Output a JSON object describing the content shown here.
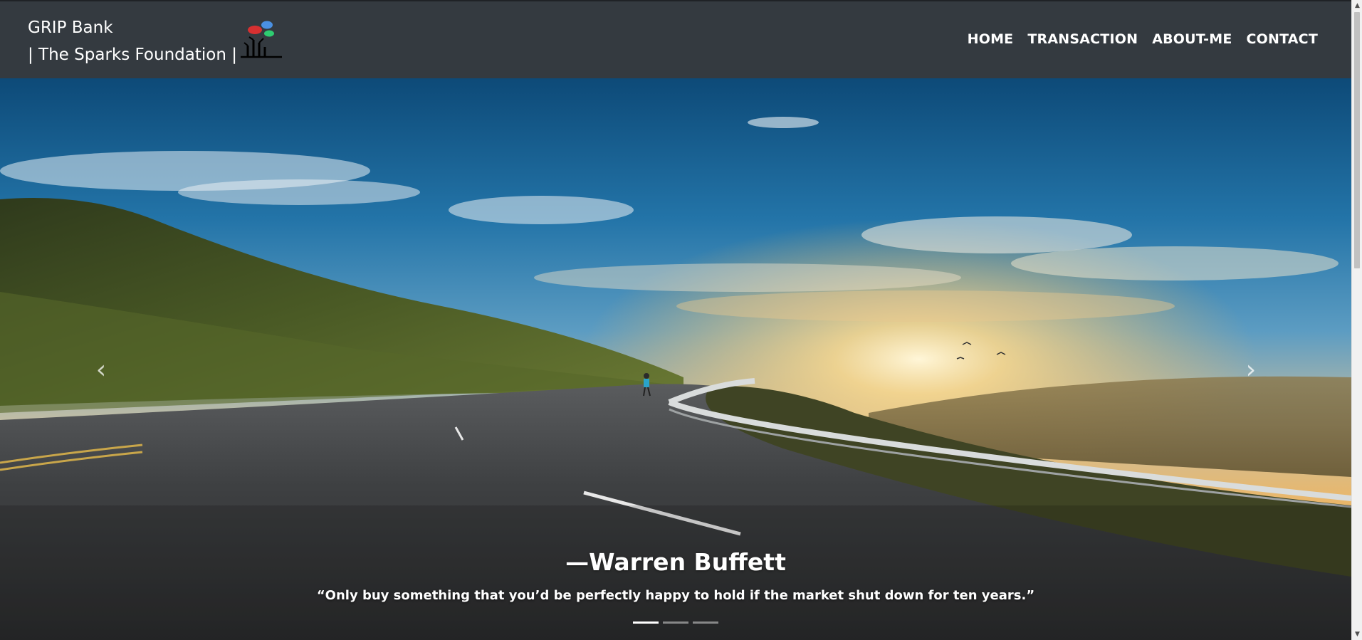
{
  "navbar": {
    "brand_line1": "GRIP Bank",
    "brand_line2": "| The Sparks Foundation |",
    "logo_icon": "sparks-foundation-logo-icon",
    "links": [
      {
        "label": "HOME"
      },
      {
        "label": "TRANSACTION"
      },
      {
        "label": "ABOUT-ME"
      },
      {
        "label": "CONTACT"
      }
    ],
    "background_color": "#343a40"
  },
  "carousel": {
    "prev_icon": "chevron-left-icon",
    "next_icon": "chevron-right-icon",
    "prev_glyph": "‹",
    "next_glyph": "›",
    "caption_author": "—Warren Buffett",
    "caption_quote": "“Only buy something that you’d be perfectly happy to hold if the market shut down for ten years.”",
    "slide_count": 3,
    "active_slide": 1
  },
  "scrollbar": {
    "up_glyph": "▲",
    "down_glyph": "▼"
  }
}
